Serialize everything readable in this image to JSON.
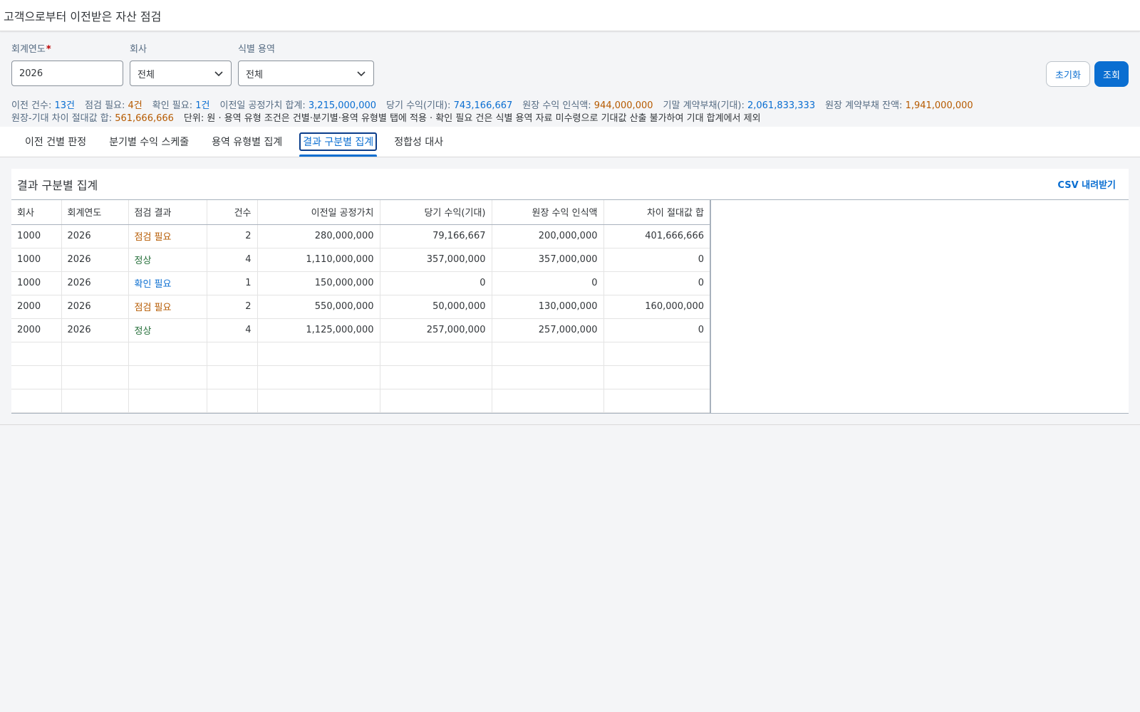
{
  "page": {
    "title": "고객으로부터 이전받은 자산 점검"
  },
  "filters": {
    "fiscal_year": {
      "label": "회계연도",
      "required_mark": "*",
      "value": "2026"
    },
    "company": {
      "label": "회사",
      "value": "전체"
    },
    "service": {
      "label": "식별 용역",
      "value": "전체"
    }
  },
  "buttons": {
    "reset": "초기화",
    "search": "조회"
  },
  "summary": {
    "items": [
      {
        "label": "이전 건수: ",
        "value": "13건",
        "color": "blue"
      },
      {
        "label": "점검 필요: ",
        "value": "4건",
        "color": "orange"
      },
      {
        "label": "확인 필요: ",
        "value": "1건",
        "color": "blue"
      },
      {
        "label": "이전일 공정가치 합계: ",
        "value": "3,215,000,000",
        "color": "blue"
      },
      {
        "label": "당기 수익(기대): ",
        "value": "743,166,667",
        "color": "blue"
      },
      {
        "label": "원장 수익 인식액: ",
        "value": "944,000,000",
        "color": "orange"
      },
      {
        "label": "기말 계약부채(기대): ",
        "value": "2,061,833,333",
        "color": "blue"
      },
      {
        "label": "원장 계약부채 잔액: ",
        "value": "1,941,000,000",
        "color": "orange"
      }
    ],
    "diff_label": "원장-기대 차이 절대값 합: ",
    "diff_value": "561,666,666",
    "note": "단위: 원 · 용역 유형 조건은 건별·분기별·용역 유형별 탭에 적용 · 확인 필요 건은 식별 용역 자료 미수령으로 기대값 산출 불가하여 기대 합계에서 제외"
  },
  "tabs": [
    {
      "label": "이전 건별 판정",
      "active": false
    },
    {
      "label": "분기별 수익 스케줄",
      "active": false
    },
    {
      "label": "용역 유형별 집계",
      "active": false
    },
    {
      "label": "결과 구분별 집계",
      "active": true
    },
    {
      "label": "정합성 대사",
      "active": false
    }
  ],
  "panel": {
    "title": "결과 구분별 집계",
    "csv_label": "CSV 내려받기"
  },
  "table": {
    "headers": [
      "회사",
      "회계연도",
      "점검 결과",
      "건수",
      "이전일 공정가치",
      "당기 수익(기대)",
      "원장 수익 인식액",
      "차이 절대값 합"
    ],
    "rows": [
      {
        "company": "1000",
        "year": "2026",
        "result": "점검 필요",
        "status": "orange",
        "count": "2",
        "fair_value": "280,000,000",
        "expected": "79,166,667",
        "ledger": "200,000,000",
        "diff": "401,666,666"
      },
      {
        "company": "1000",
        "year": "2026",
        "result": "정상",
        "status": "green",
        "count": "4",
        "fair_value": "1,110,000,000",
        "expected": "357,000,000",
        "ledger": "357,000,000",
        "diff": "0"
      },
      {
        "company": "1000",
        "year": "2026",
        "result": "확인 필요",
        "status": "blue",
        "count": "1",
        "fair_value": "150,000,000",
        "expected": "0",
        "ledger": "0",
        "diff": "0"
      },
      {
        "company": "2000",
        "year": "2026",
        "result": "점검 필요",
        "status": "orange",
        "count": "2",
        "fair_value": "550,000,000",
        "expected": "50,000,000",
        "ledger": "130,000,000",
        "diff": "160,000,000"
      },
      {
        "company": "2000",
        "year": "2026",
        "result": "정상",
        "status": "green",
        "count": "4",
        "fair_value": "1,125,000,000",
        "expected": "257,000,000",
        "ledger": "257,000,000",
        "diff": "0"
      }
    ],
    "empty_rows": 3
  },
  "colors": {
    "accent": "#0a6ed1",
    "warning": "#b65a00",
    "success": "#256f3a"
  }
}
